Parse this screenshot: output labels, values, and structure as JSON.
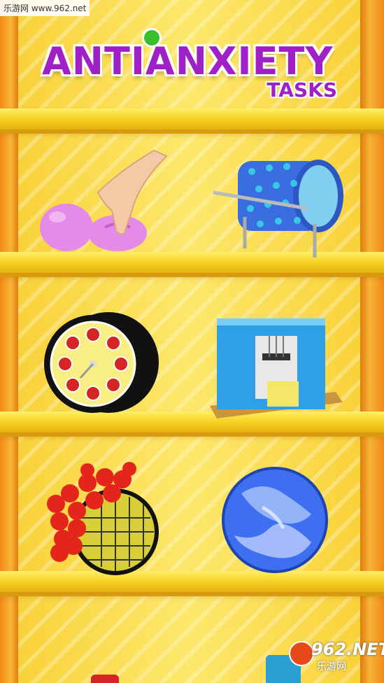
{
  "watermark_top": "乐游网 www.962.net",
  "watermark_bottom": {
    "number": "962.NET",
    "chinese": "乐游网"
  },
  "title": {
    "main": "ANTIANXIETY",
    "sub": "TASKS"
  },
  "items": [
    {
      "name": "squishy-putty-ball"
    },
    {
      "name": "spiked-roller"
    },
    {
      "name": "bubble-wrap-wheel"
    },
    {
      "name": "blue-box-machine"
    },
    {
      "name": "red-bead-mesh-ball"
    },
    {
      "name": "blue-marble-ball"
    }
  ],
  "colors": {
    "accent": "#a020c8",
    "shelf": "#f7d426",
    "frame": "#f08a12"
  }
}
